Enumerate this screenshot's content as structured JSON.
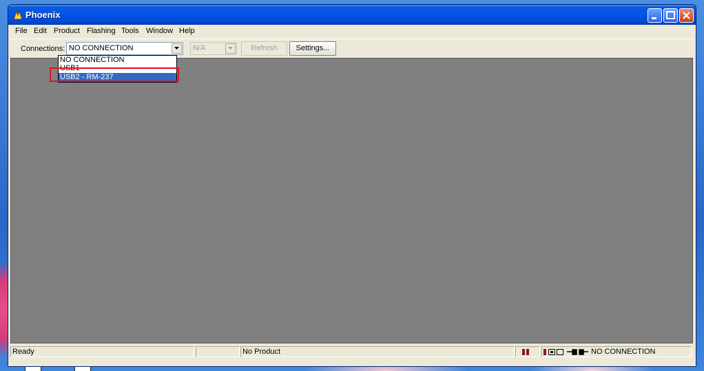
{
  "app": {
    "title": "Phoenix"
  },
  "menu": [
    "File",
    "Edit",
    "Product",
    "Flashing",
    "Tools",
    "Window",
    "Help"
  ],
  "toolbar": {
    "connections_label": "Connections:",
    "connection_value": "NO CONNECTION",
    "product_value": "N/A",
    "refresh_label": "Refresh",
    "settings_label": "Settings..."
  },
  "dropdown": {
    "options": [
      "NO CONNECTION",
      "USB1",
      "USB2 - RM-237"
    ],
    "selected_index": 2
  },
  "status": {
    "ready": "Ready",
    "product": "No Product",
    "connection": "NO CONNECTION"
  },
  "colors": {
    "highlight_box": "#e0131b",
    "selection": "#316ac5",
    "workspace": "#808080",
    "titlebar": "#0454e8"
  },
  "icons": [
    "phoenix-app-icon",
    "minimize-icon",
    "maximize-icon",
    "close-icon",
    "dropdown-arrow-icon",
    "connection-plug-icon"
  ]
}
